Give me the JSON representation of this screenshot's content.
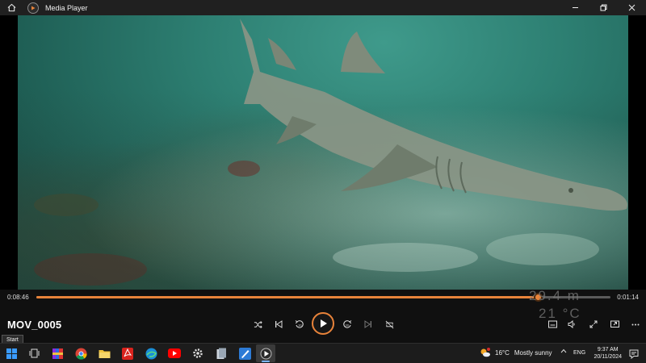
{
  "window": {
    "title": "Media Player",
    "icons": {
      "home": "home-icon",
      "app": "media-player-icon",
      "minimize": "minimize-icon",
      "maximize": "restore-icon",
      "close": "close-icon"
    }
  },
  "player": {
    "file_title": "MOV_0005",
    "elapsed": "0:08:46",
    "remaining": "0:01:14",
    "progress": 0.873,
    "video_overlay": {
      "depth": "29.4 m",
      "temperature": "21 °C"
    },
    "controls": {
      "shuffle": "shuffle-icon",
      "previous": "previous-icon",
      "skip_back": "skip-back-10-icon",
      "play": "play-icon",
      "skip_forward": "skip-forward-30-icon",
      "next": "next-icon",
      "repeat": "repeat-off-icon",
      "miniplayer": "miniplayer-icon",
      "volume": "volume-icon",
      "fullscreen": "fullscreen-icon",
      "cast": "cast-icon",
      "more": "more-icon"
    },
    "accent": "#e8833a"
  },
  "tooltip": {
    "text": "Start"
  },
  "taskbar": {
    "apps": [
      "windows-start-icon",
      "task-view-icon",
      "winrar-icon",
      "chrome-icon",
      "file-explorer-icon",
      "acrobat-icon",
      "edge-icon",
      "youtube-icon",
      "settings-icon",
      "files-icon",
      "paint-icon",
      "media-player-icon"
    ],
    "weather": {
      "temp": "16°C",
      "condition": "Mostly sunny",
      "icon": "partly-sunny-icon",
      "badge": "1"
    },
    "tray": {
      "chevron": "chevron-up-icon",
      "language": "ENG"
    },
    "clock": {
      "time": "9:37 AM",
      "date": "20/11/2024"
    },
    "notification": "notification-icon"
  }
}
